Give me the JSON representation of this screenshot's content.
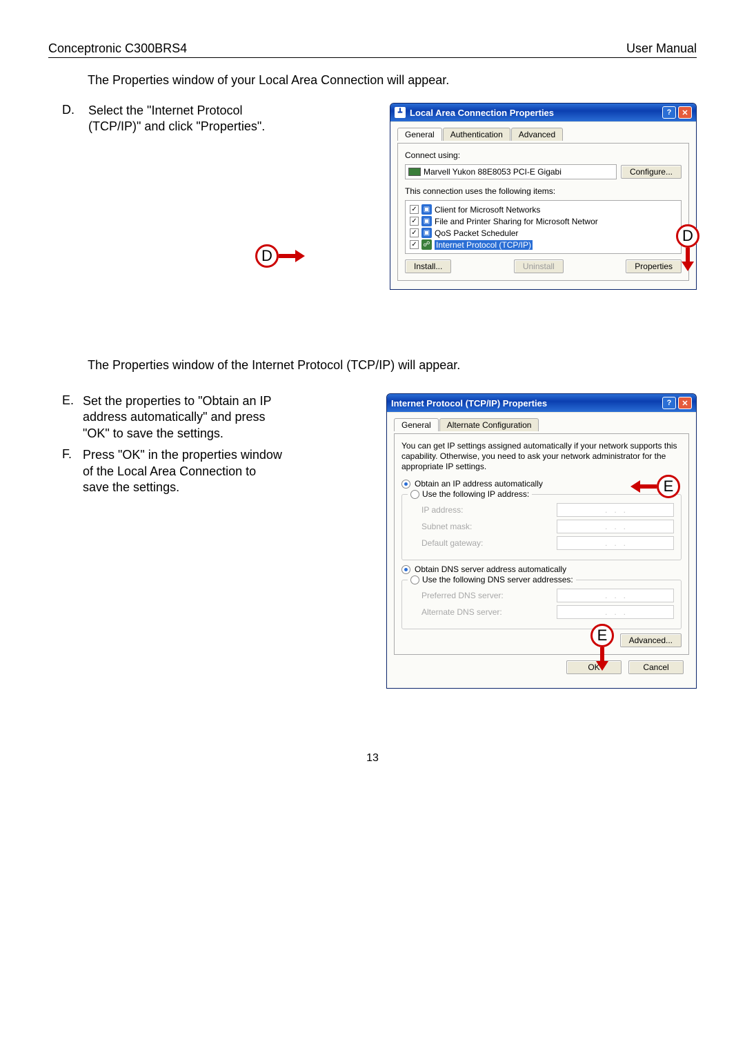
{
  "header": {
    "left": "Conceptronic C300BRS4",
    "right": "User Manual"
  },
  "intro1": "The Properties window of your Local Area Connection will appear.",
  "stepD": {
    "letter": "D.",
    "text": "Select the \"Internet Protocol (TCP/IP)\" and click \"Properties\"."
  },
  "lan_window": {
    "title": "Local Area Connection Properties",
    "tabs": [
      "General",
      "Authentication",
      "Advanced"
    ],
    "connect_using_label": "Connect using:",
    "adapter": "Marvell Yukon 88E8053 PCI-E Gigabi",
    "configure_btn": "Configure...",
    "items_label": "This connection uses the following items:",
    "items": [
      {
        "checked": true,
        "icon": "client-icon",
        "text": "Client for Microsoft Networks"
      },
      {
        "checked": true,
        "icon": "service-icon",
        "text": "File and Printer Sharing for Microsoft Networ"
      },
      {
        "checked": true,
        "icon": "service-icon",
        "text": "QoS Packet Scheduler"
      },
      {
        "checked": true,
        "icon": "protocol-icon",
        "text": "Internet Protocol (TCP/IP)",
        "selected": true
      }
    ],
    "install_btn": "Install...",
    "uninstall_btn": "Uninstall",
    "properties_btn": "Properties"
  },
  "annotD": "D",
  "intro2": "The Properties window of the Internet Protocol (TCP/IP) will appear.",
  "stepE": {
    "letter": "E.",
    "text": "Set the properties to \"Obtain an IP address automatically\" and press \"OK\" to save the settings."
  },
  "stepF": {
    "letter": "F.",
    "text": "Press \"OK\" in the properties window of the Local Area Connection to save the settings."
  },
  "tcpip_window": {
    "title": "Internet Protocol (TCP/IP) Properties",
    "tabs": [
      "General",
      "Alternate Configuration"
    ],
    "desc": "You can get IP settings assigned automatically if your network supports this capability. Otherwise, you need to ask your network administrator for the appropriate IP settings.",
    "obtain_ip": "Obtain an IP address automatically",
    "use_ip": "Use the following IP address:",
    "ip_label": "IP address:",
    "subnet_label": "Subnet mask:",
    "gateway_label": "Default gateway:",
    "obtain_dns": "Obtain DNS server address automatically",
    "use_dns": "Use the following DNS server addresses:",
    "pref_dns": "Preferred DNS server:",
    "alt_dns": "Alternate DNS server:",
    "advanced_btn": "Advanced...",
    "ok_btn": "OK",
    "cancel_btn": "Cancel"
  },
  "annotE": "E",
  "pagenum": "13"
}
